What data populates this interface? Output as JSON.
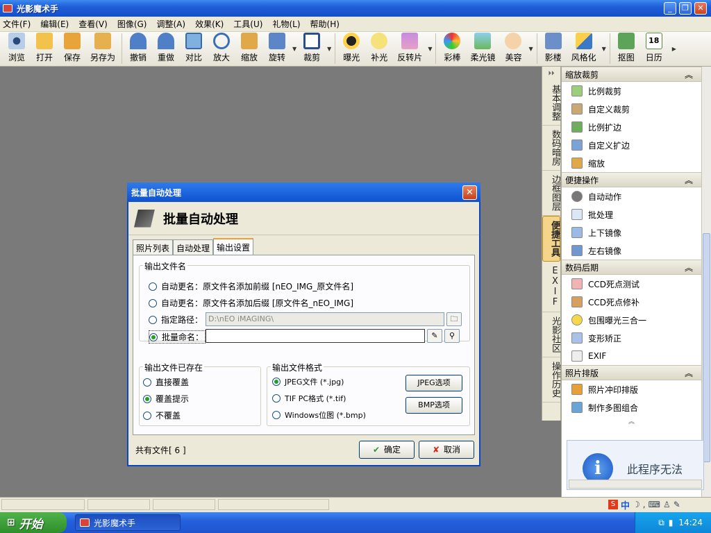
{
  "app": {
    "title": "光影魔术手"
  },
  "window_buttons": {
    "minimize": "_",
    "restore": "❐",
    "close": "✕"
  },
  "menu": [
    "文件(F)",
    "编辑(E)",
    "查看(V)",
    "图像(G)",
    "调整(A)",
    "效果(K)",
    "工具(U)",
    "礼物(L)",
    "帮助(H)"
  ],
  "toolbar": [
    {
      "label": "浏览",
      "icon": "eye-icon"
    },
    {
      "label": "打开",
      "icon": "folder-open-icon"
    },
    {
      "label": "保存",
      "icon": "save-icon"
    },
    {
      "label": "另存为",
      "icon": "save-as-icon"
    },
    {
      "label": "撤销",
      "icon": "undo-icon"
    },
    {
      "label": "重做",
      "icon": "redo-icon"
    },
    {
      "label": "对比",
      "icon": "compare-icon"
    },
    {
      "label": "放大",
      "icon": "zoom-in-icon"
    },
    {
      "label": "缩放",
      "icon": "resize-icon"
    },
    {
      "label": "旋转",
      "icon": "rotate-icon"
    },
    {
      "label": "裁剪",
      "icon": "crop-icon"
    },
    {
      "label": "曝光",
      "icon": "exposure-icon"
    },
    {
      "label": "补光",
      "icon": "fill-light-icon"
    },
    {
      "label": "反转片",
      "icon": "reversal-film-icon"
    },
    {
      "label": "彩棒",
      "icon": "color-wand-icon"
    },
    {
      "label": "柔光镜",
      "icon": "soft-light-icon"
    },
    {
      "label": "美容",
      "icon": "beauty-icon"
    },
    {
      "label": "影楼",
      "icon": "studio-icon"
    },
    {
      "label": "风格化",
      "icon": "stylize-icon"
    },
    {
      "label": "抠图",
      "icon": "cutout-icon"
    },
    {
      "label": "日历",
      "icon": "calendar-icon",
      "badge": "18"
    }
  ],
  "vtabs": [
    "基本调整",
    "数码暗房",
    "边框图层",
    "便捷工具",
    "EXIF",
    "光影社区",
    "操作历史"
  ],
  "panel": [
    {
      "header": "缩放裁剪",
      "items": [
        "比例裁剪",
        "自定义裁剪",
        "比例扩边",
        "自定义扩边",
        "缩放"
      ]
    },
    {
      "header": "便捷操作",
      "items": [
        "自动动作",
        "批处理",
        "上下镜像",
        "左右镜像"
      ]
    },
    {
      "header": "数码后期",
      "items": [
        "CCD死点测试",
        "CCD死点修补",
        "包围曝光三合一",
        "变形矫正",
        "EXIF"
      ]
    },
    {
      "header": "照片排版",
      "items": [
        "照片冲印排版",
        "制作多图组合"
      ]
    }
  ],
  "infobox": {
    "text": "此程序无法"
  },
  "dialog": {
    "title": "批量自动处理",
    "header": "批量自动处理",
    "tabs": [
      "照片列表",
      "自动处理",
      "输出设置"
    ],
    "output_name": {
      "group": "输出文件名",
      "opt1": "自动更名：原文件名添加前缀 [nEO_IMG_原文件名]",
      "opt2": "自动更名：原文件名添加后缀 [原文件名_nEO_IMG]",
      "opt3": "指定路径：",
      "path_value": "D:\\nEO iMAGING\\",
      "opt4": "批量命名：",
      "rename_value": ""
    },
    "exists": {
      "group": "输出文件已存在",
      "opts": [
        "直接覆盖",
        "覆盖提示",
        "不覆盖"
      ]
    },
    "format": {
      "group": "输出文件格式",
      "opts": [
        "JPEG文件 (*.jpg)",
        "TIF PC格式 (*.tif)",
        "Windows位图 (*.bmp)"
      ],
      "jpeg_btn": "JPEG选项",
      "bmp_btn": "BMP选项"
    },
    "total": "共有文件[ 6 ]",
    "ok": "确定",
    "cancel": "取消"
  },
  "taskbar": {
    "start": "开始",
    "item": "光影魔术手",
    "time": "14:24"
  }
}
